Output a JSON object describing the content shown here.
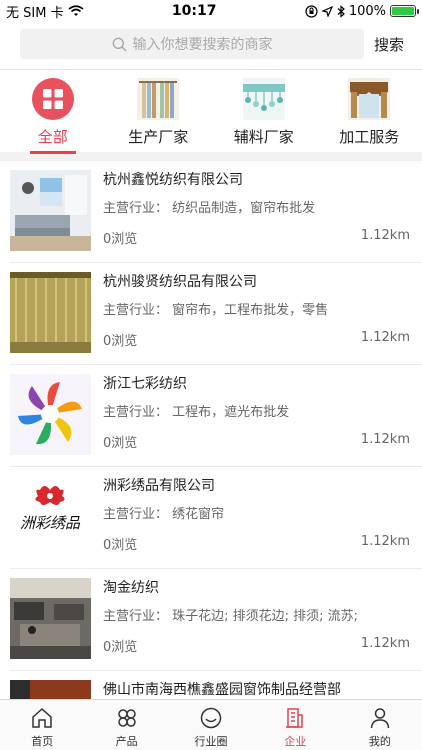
{
  "status_bar": {
    "carrier": "无 SIM 卡",
    "time": "10:17",
    "battery": "100%"
  },
  "search": {
    "placeholder": "输入你想要搜索的商家",
    "button": "搜索"
  },
  "categories": [
    {
      "label": "全部",
      "active": true
    },
    {
      "label": "生产厂家",
      "active": false
    },
    {
      "label": "辅料厂家",
      "active": false
    },
    {
      "label": "加工服务",
      "active": false
    }
  ],
  "companies": [
    {
      "name": "杭州鑫悦纺织有限公司",
      "business": "主营行业：  纺织品制造，窗帘布批发",
      "views": "0浏览",
      "distance": "1.12km"
    },
    {
      "name": "杭州骏贤纺织品有限公司",
      "business": "主营行业：  窗帘布，工程布批发，零售",
      "views": "0浏览",
      "distance": "1.12km"
    },
    {
      "name": "浙江七彩纺织",
      "business": "主营行业：  工程布，遮光布批发",
      "views": "0浏览",
      "distance": "1.12km"
    },
    {
      "name": "洲彩绣品有限公司",
      "business": "主营行业：  绣花窗帘",
      "views": "0浏览",
      "distance": "1.12km"
    },
    {
      "name": "淘金纺织",
      "business": "主营行业：  珠子花边; 排须花边; 排须; 流苏;",
      "views": "0浏览",
      "distance": "1.12km"
    },
    {
      "name": "佛山市南海西樵鑫盛园窗饰制品经营部",
      "business": "",
      "views": "",
      "distance": ""
    }
  ],
  "logo_text": "洲彩绣品",
  "tabbar": [
    {
      "label": "首页"
    },
    {
      "label": "产品"
    },
    {
      "label": "行业圈"
    },
    {
      "label": "企业",
      "active": true
    },
    {
      "label": "我的"
    }
  ],
  "colors": {
    "accent": "#e8404d"
  }
}
